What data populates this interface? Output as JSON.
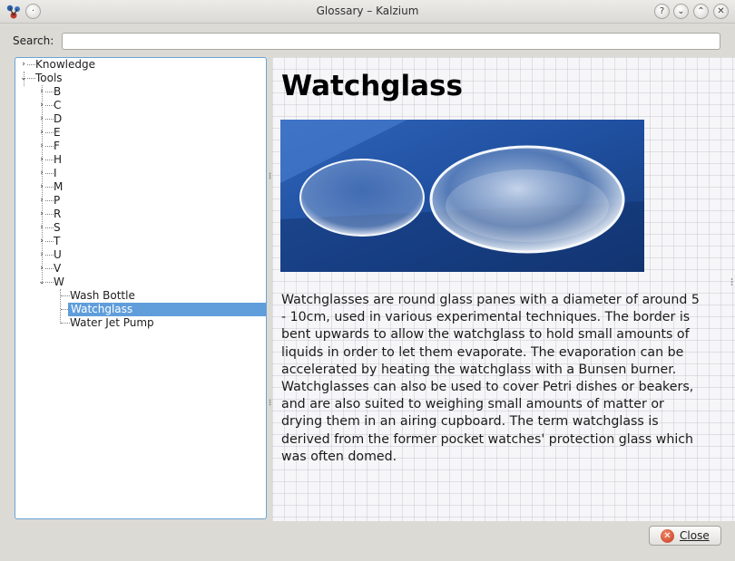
{
  "window": {
    "title": "Glossary – Kalzium",
    "buttons": {
      "help": "?",
      "minimize": "⌄",
      "maximize": "⌃",
      "close": "✕"
    }
  },
  "search": {
    "label": "Search:",
    "value": ""
  },
  "tree": {
    "items": [
      {
        "label": "Knowledge",
        "expander": "›"
      },
      {
        "label": "Tools",
        "expander": "⌄"
      },
      {
        "label": "B",
        "expander": "›"
      },
      {
        "label": "C",
        "expander": "›"
      },
      {
        "label": "D",
        "expander": "›"
      },
      {
        "label": "E",
        "expander": "›"
      },
      {
        "label": "F",
        "expander": "›"
      },
      {
        "label": "H",
        "expander": "›"
      },
      {
        "label": "I",
        "expander": "›"
      },
      {
        "label": "M",
        "expander": "›"
      },
      {
        "label": "P",
        "expander": "›"
      },
      {
        "label": "R",
        "expander": "›"
      },
      {
        "label": "S",
        "expander": "›"
      },
      {
        "label": "T",
        "expander": "›"
      },
      {
        "label": "U",
        "expander": "›"
      },
      {
        "label": "V",
        "expander": "›"
      },
      {
        "label": "W",
        "expander": "⌄"
      },
      {
        "label": "Wash Bottle",
        "expander": ""
      },
      {
        "label": "Watchglass",
        "expander": "",
        "selected": true
      },
      {
        "label": "Water Jet Pump",
        "expander": ""
      }
    ]
  },
  "article": {
    "title": "Watchglass",
    "body": "Watchglasses are round glass panes with a diameter of around 5 - 10cm, used in various experimental techniques. The border is bent upwards to allow the watchglass to hold small amounts of liquids in order to let them evaporate. The evaporation can be accelerated by heating the watchglass with a Bunsen burner. Watchglasses can also be used to cover Petri dishes or beakers, and are also suited to weighing small amounts of matter or drying them in an airing cupboard. The term watchglass is derived from the former pocket watches' protection glass which was often domed."
  },
  "footer": {
    "close_label": "Close"
  },
  "icons": {
    "app": "kalzium-app-icon",
    "close_button": "close-circle-icon"
  },
  "colors": {
    "selection": "#5f9ddb",
    "tree_border": "#6aa3d6",
    "window_bg": "#dcdad5"
  }
}
